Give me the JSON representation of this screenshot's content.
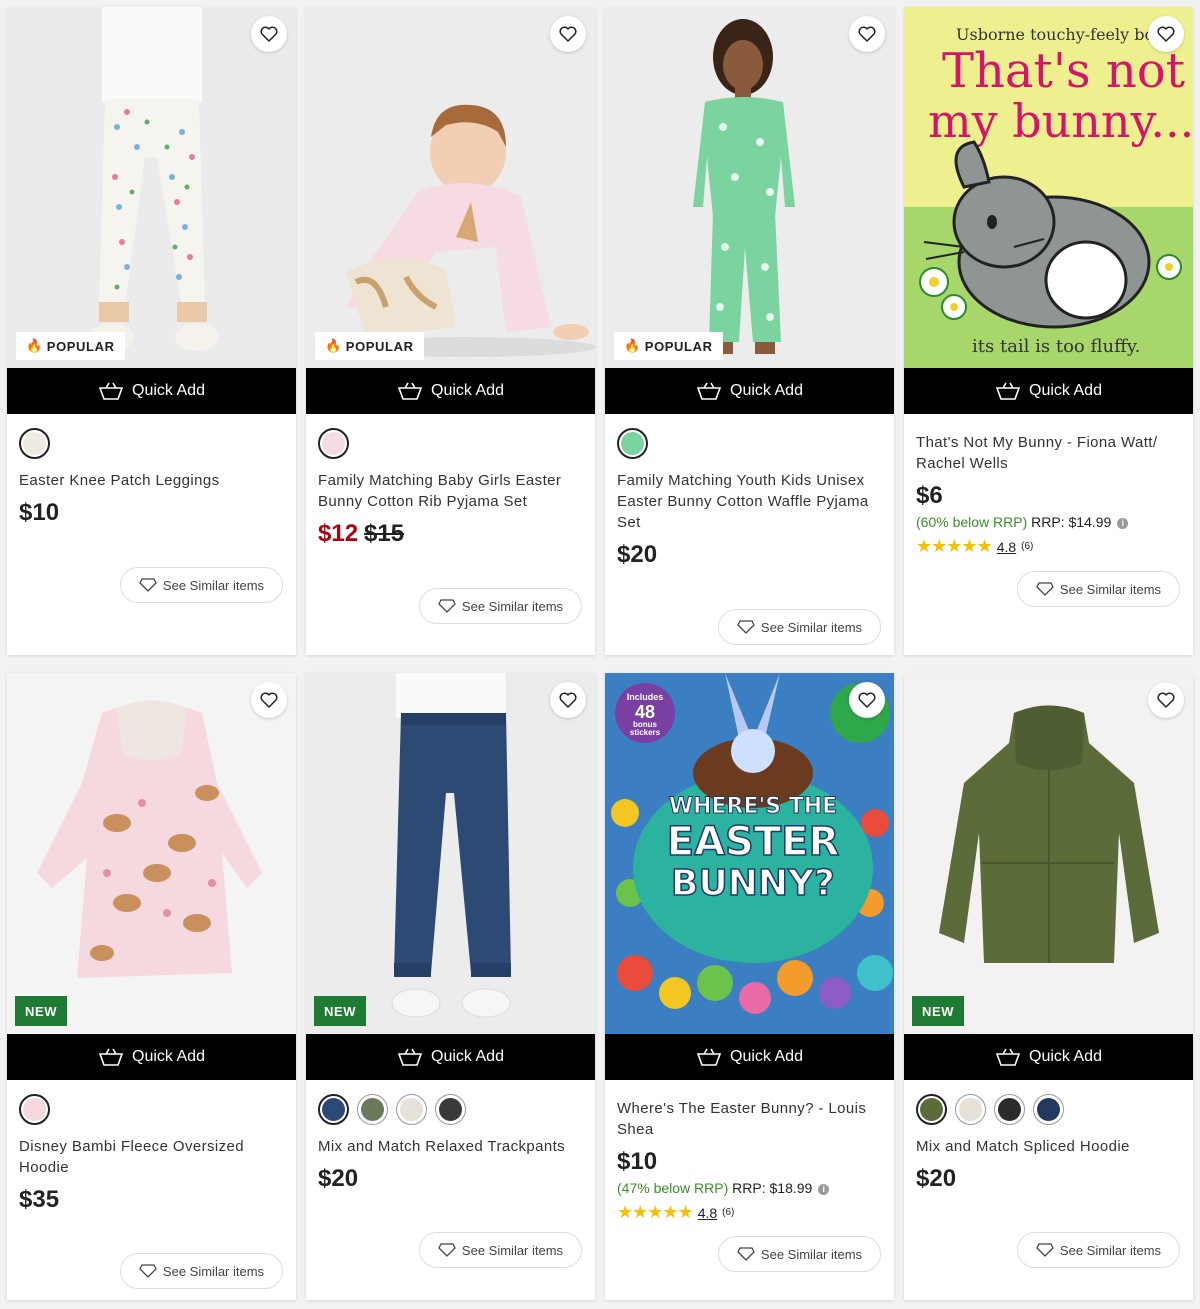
{
  "products": [
    {
      "title": "Easter Knee Patch Leggings",
      "price": "$10",
      "badge": "POPULAR",
      "quick_add": "Quick Add",
      "similar": "See Similar items"
    },
    {
      "title": "Family Matching Baby Girls Easter Bunny Cotton Rib Pyjama Set",
      "price_sale": "$12",
      "price_was": "$15",
      "badge": "POPULAR",
      "quick_add": "Quick Add",
      "similar": "See Similar items"
    },
    {
      "title": "Family Matching Youth Kids Unisex Easter Bunny Cotton Waffle Pyjama Set",
      "price": "$20",
      "badge": "POPULAR",
      "quick_add": "Quick Add",
      "similar": "See Similar items"
    },
    {
      "title": "That's Not My Bunny - Fiona Watt/ Rachel Wells",
      "price": "$6",
      "rrp_pct": "(60% below RRP)",
      "rrp": "RRP: $14.99",
      "rating": "4.8",
      "rating_count": "(6)",
      "quick_add": "Quick Add",
      "similar": "See Similar items",
      "book_series": "Usborne touchy-feely books",
      "book_title_1": "That's not",
      "book_title_2": "my bunny...",
      "book_caption": "its tail is too fluffy."
    },
    {
      "title": "Disney Bambi Fleece Oversized Hoodie",
      "price": "$35",
      "badge": "NEW",
      "quick_add": "Quick Add",
      "similar": "See Similar items"
    },
    {
      "title": "Mix and Match Relaxed Trackpants",
      "price": "$20",
      "badge": "NEW",
      "quick_add": "Quick Add",
      "similar": "See Similar items"
    },
    {
      "title": "Where's The Easter Bunny? - Louis Shea",
      "price": "$10",
      "rrp_pct": "(47% below RRP)",
      "rrp": "RRP: $18.99",
      "rating": "4.8",
      "rating_count": "(6)",
      "quick_add": "Quick Add",
      "similar": "See Similar items",
      "book_title_1": "WHERE'S THE",
      "book_title_2": "EASTER",
      "book_title_3": "BUNNY?",
      "book_badge_1": "Includes",
      "book_badge_2": "48",
      "book_badge_3": "bonus",
      "book_badge_4": "stickers"
    },
    {
      "title": "Mix and Match Spliced Hoodie",
      "price": "$20",
      "badge": "NEW",
      "quick_add": "Quick Add",
      "similar": "See Similar items"
    }
  ],
  "colors": {
    "sale": "#b1000e",
    "rrp_green": "#3a8f2a",
    "new_badge": "#1f7a33",
    "star": "#f2c200"
  },
  "icons": {
    "wishlist": "heart-icon",
    "quick_add": "basket-icon",
    "similar": "similar-icon",
    "popular": "flame-icon"
  }
}
